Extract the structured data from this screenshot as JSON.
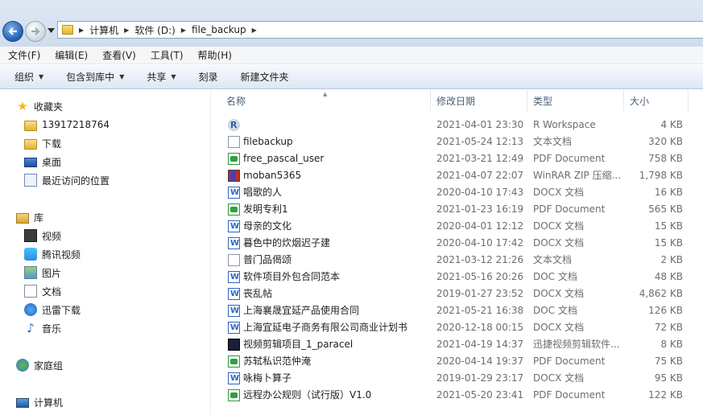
{
  "breadcrumb": [
    "计算机",
    "软件 (D:)",
    "file_backup"
  ],
  "menu": [
    "文件(F)",
    "编辑(E)",
    "查看(V)",
    "工具(T)",
    "帮助(H)"
  ],
  "commands": [
    {
      "label": "组织",
      "dropdown": true
    },
    {
      "label": "包含到库中",
      "dropdown": true
    },
    {
      "label": "共享",
      "dropdown": true
    },
    {
      "label": "刻录",
      "dropdown": false
    },
    {
      "label": "新建文件夹",
      "dropdown": false
    }
  ],
  "nav": {
    "favorites": "收藏夹",
    "fav_items": [
      "13917218764",
      "下载",
      "桌面",
      "最近访问的位置"
    ],
    "libraries": "库",
    "lib_items": [
      "视频",
      "腾讯视频",
      "图片",
      "文档",
      "迅雷下载",
      "音乐"
    ],
    "homegroup": "家庭组",
    "computer": "计算机"
  },
  "columns": {
    "name": "名称",
    "date": "修改日期",
    "type": "类型",
    "size": "大小"
  },
  "files": [
    {
      "name": "",
      "date": "2021-04-01 23:30",
      "type": "R Workspace",
      "size": "4 KB",
      "icon": "r-workspace-icon"
    },
    {
      "name": "filebackup",
      "date": "2021-05-24 12:13",
      "type": "文本文档",
      "size": "320 KB",
      "icon": "text-file-icon"
    },
    {
      "name": "free_pascal_user",
      "date": "2021-03-21 12:49",
      "type": "PDF Document",
      "size": "758 KB",
      "icon": "pdf-icon"
    },
    {
      "name": "moban5365",
      "date": "2021-04-07 22:07",
      "type": "WinRAR ZIP 压缩...",
      "size": "1,798 KB",
      "icon": "winrar-icon"
    },
    {
      "name": "唱歌的人",
      "date": "2020-04-10 17:43",
      "type": "DOCX 文档",
      "size": "16 KB",
      "icon": "word-icon"
    },
    {
      "name": "发明专利1",
      "date": "2021-01-23 16:19",
      "type": "PDF Document",
      "size": "565 KB",
      "icon": "pdf-icon"
    },
    {
      "name": "母亲的文化",
      "date": "2020-04-01 12:12",
      "type": "DOCX 文档",
      "size": "15 KB",
      "icon": "word-icon"
    },
    {
      "name": "暮色中的炊烟迟子建",
      "date": "2020-04-10 17:42",
      "type": "DOCX 文档",
      "size": "15 KB",
      "icon": "word-icon"
    },
    {
      "name": "普门品偈颂",
      "date": "2021-03-12 21:26",
      "type": "文本文档",
      "size": "2 KB",
      "icon": "text-file-icon"
    },
    {
      "name": "软件项目外包合同范本",
      "date": "2021-05-16 20:26",
      "type": "DOC 文档",
      "size": "48 KB",
      "icon": "word-icon"
    },
    {
      "name": "丧乱帖",
      "date": "2019-01-27 23:52",
      "type": "DOCX 文档",
      "size": "4,862 KB",
      "icon": "word-icon"
    },
    {
      "name": "上海襄晟宜延产品使用合同",
      "date": "2021-05-21 16:38",
      "type": "DOC 文档",
      "size": "126 KB",
      "icon": "word-icon"
    },
    {
      "name": "上海宜延电子商务有限公司商业计划书",
      "date": "2020-12-18 00:15",
      "type": "DOCX 文档",
      "size": "72 KB",
      "icon": "word-icon"
    },
    {
      "name": "视频剪辑项目_1_paracel",
      "date": "2021-04-19 14:37",
      "type": "迅捷视频剪辑软件...",
      "size": "8 KB",
      "icon": "video-project-icon"
    },
    {
      "name": "苏轼私识范仲淹",
      "date": "2020-04-14 19:37",
      "type": "PDF Document",
      "size": "75 KB",
      "icon": "pdf-icon"
    },
    {
      "name": "咏梅卜算子",
      "date": "2019-01-29 23:17",
      "type": "DOCX 文档",
      "size": "95 KB",
      "icon": "word-icon"
    },
    {
      "name": "远程办公规则（试行版）V1.0",
      "date": "2021-05-20 23:41",
      "type": "PDF Document",
      "size": "122 KB",
      "icon": "pdf-icon"
    }
  ]
}
